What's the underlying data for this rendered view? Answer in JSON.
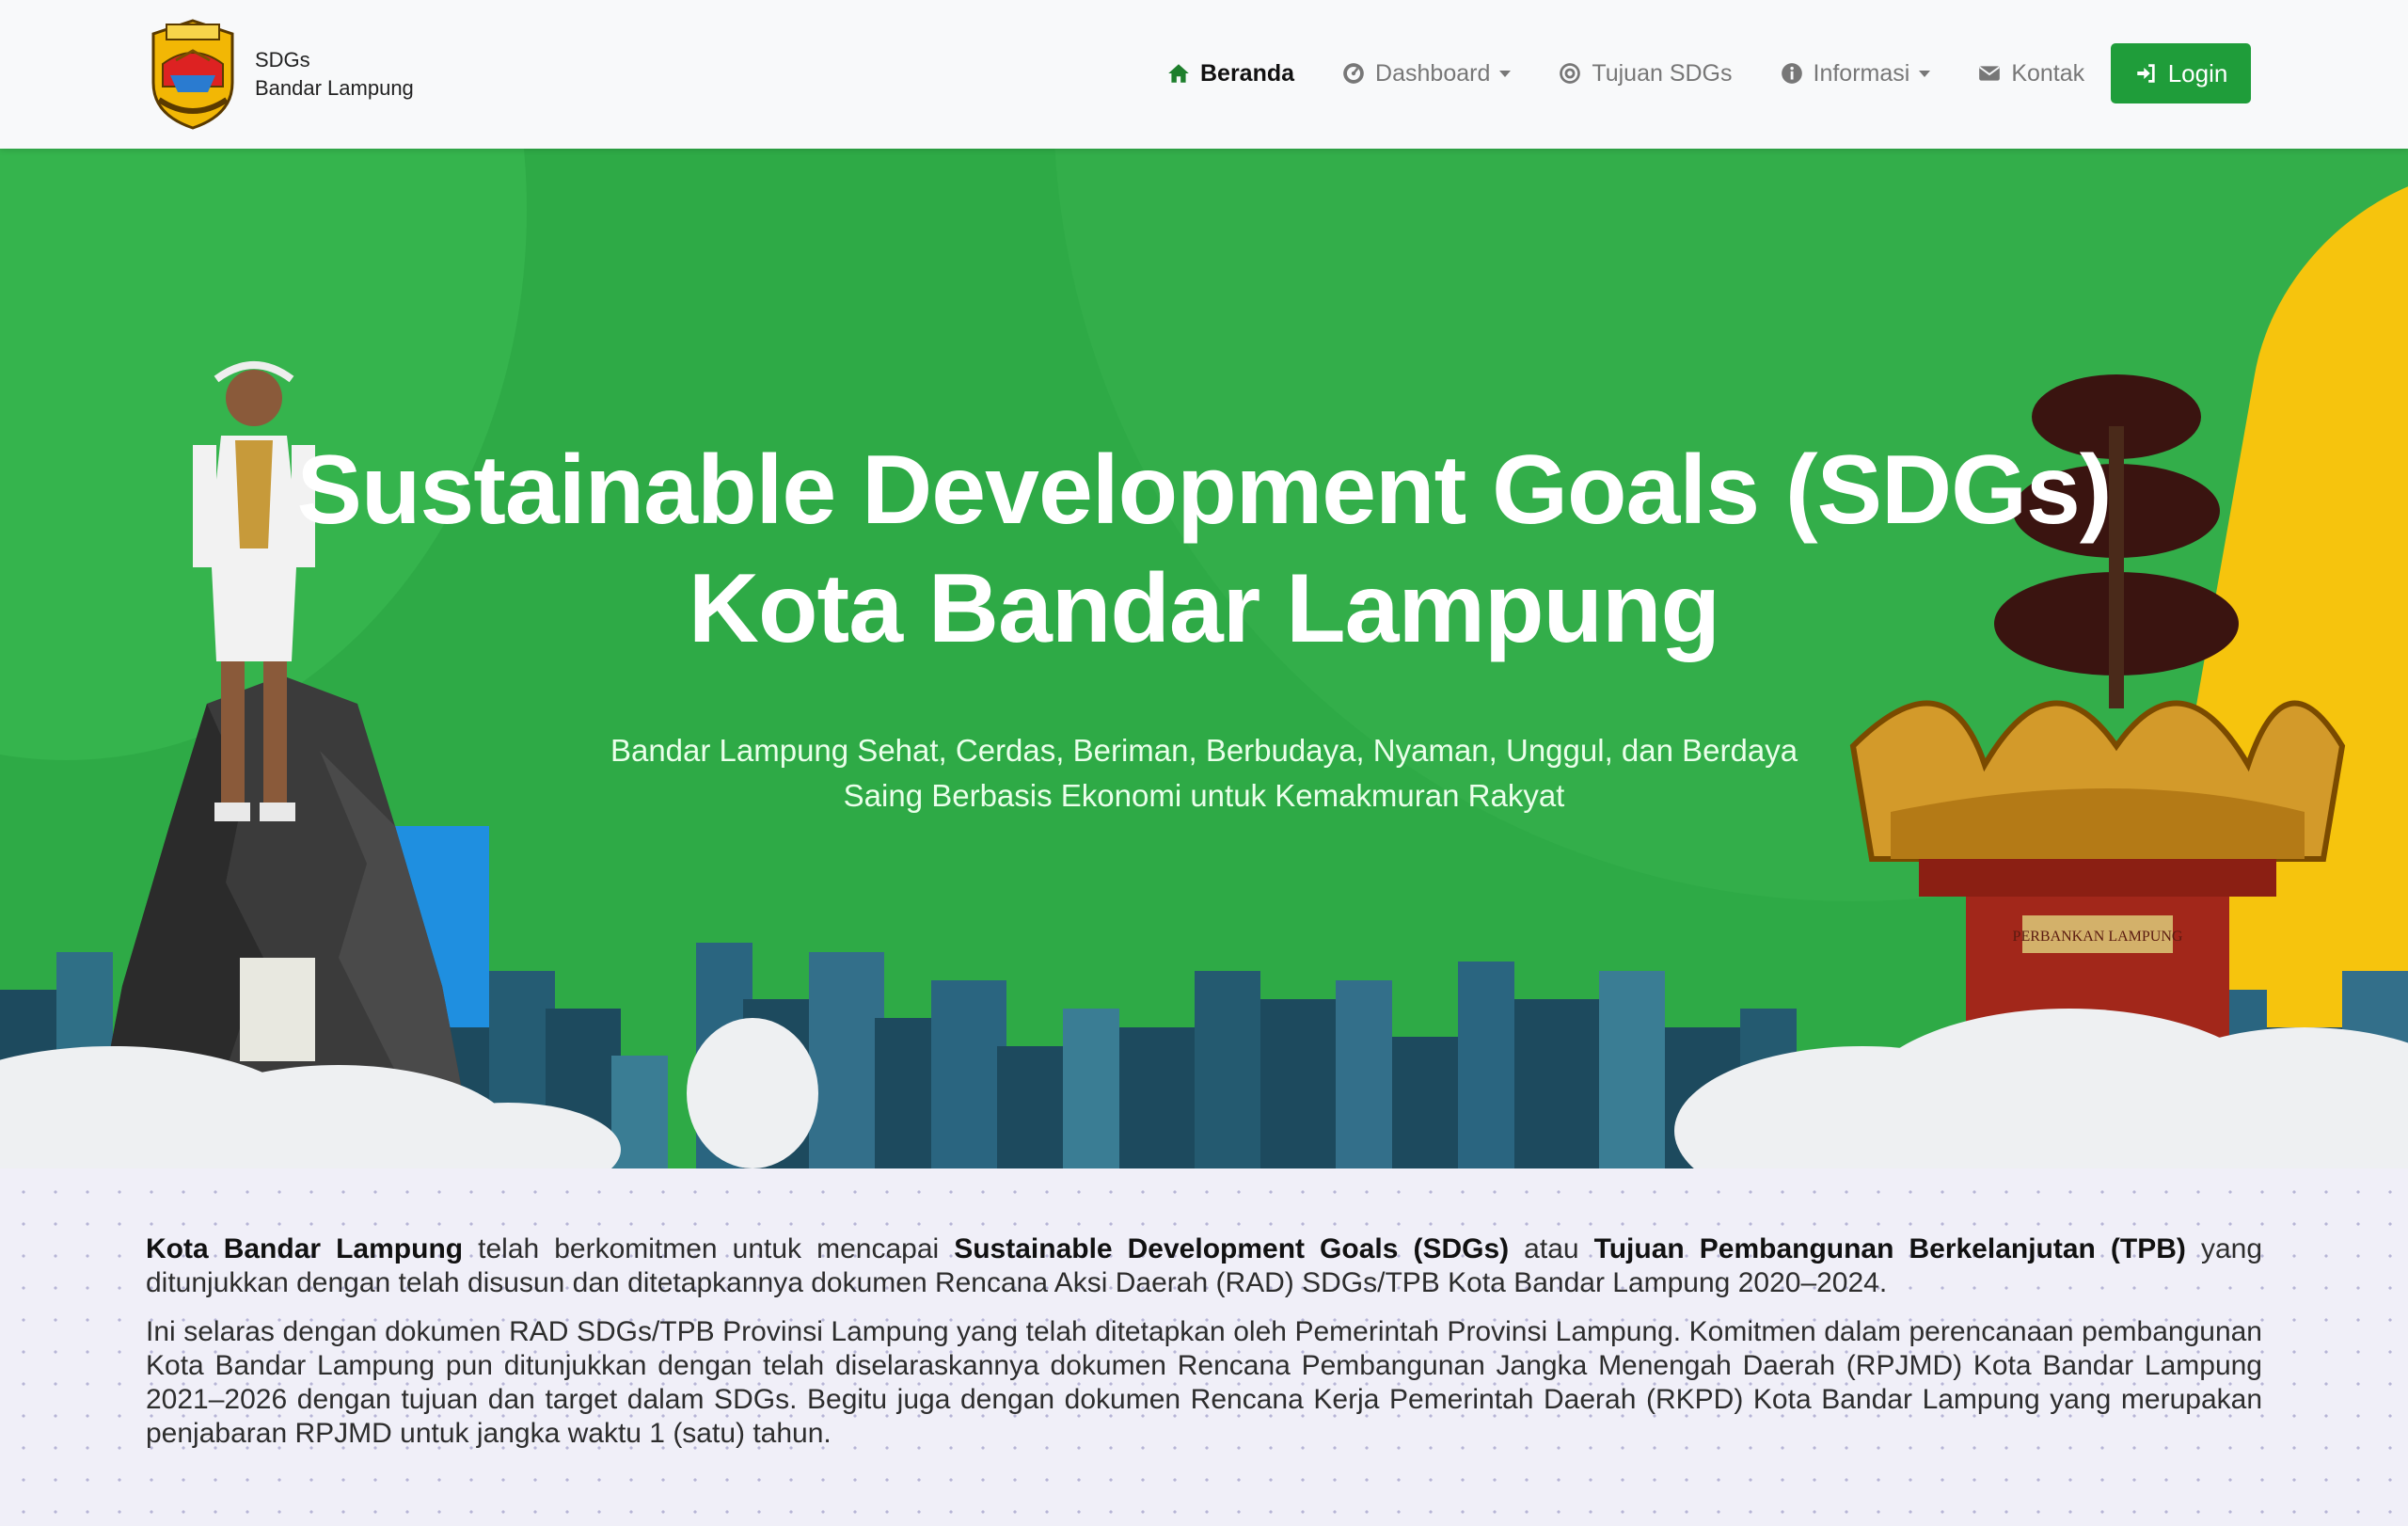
{
  "brand": {
    "line1": "SDGs",
    "line2": "Bandar Lampung",
    "logo_icon": "kota-bandar-lampung-emblem"
  },
  "nav": {
    "items": [
      {
        "label": "Beranda",
        "icon": "home-icon",
        "active": true
      },
      {
        "label": "Dashboard",
        "icon": "dashboard-icon",
        "dropdown": true
      },
      {
        "label": "Tujuan SDGs",
        "icon": "target-icon"
      },
      {
        "label": "Informasi",
        "icon": "info-icon",
        "dropdown": true
      },
      {
        "label": "Kontak",
        "icon": "envelope-icon"
      }
    ],
    "login_label": "Login"
  },
  "hero": {
    "title_line1": "Sustainable Development Goals (SDGs)",
    "title_line2": "Kota Bandar Lampung",
    "subtitle_line1": "Bandar Lampung Sehat, Cerdas, Beriman, Berbudaya, Nyaman, Unggul, dan Berdaya",
    "subtitle_line2": "Saing Berbasis Ekonomi untuk Kemakmuran Rakyat",
    "tower_plate": "PERBANKAN LAMPUNG"
  },
  "content": {
    "p1_b1": "Kota Bandar Lampung",
    "p1_t1": " telah berkomitmen untuk mencapai ",
    "p1_b2": "Sustainable Development Goals (SDGs)",
    "p1_t2": " atau ",
    "p1_b3": "Tujuan Pembangunan Berkelanjutan (TPB)",
    "p1_t3": " yang ditunjukkan dengan telah disusun dan ditetapkannya dokumen Rencana Aksi Daerah (RAD) SDGs/TPB Kota Bandar Lampung 2020–2024.",
    "p2": "Ini selaras dengan dokumen RAD SDGs/TPB Provinsi Lampung yang telah ditetapkan oleh Pemerintah Provinsi Lampung. Komitmen dalam perencanaan pembangunan Kota Bandar Lampung pun ditunjukkan dengan telah diselaraskannya dokumen Rencana Pembangunan Jangka Menengah Daerah (RPJMD) Kota Bandar Lampung 2021–2026 dengan tujuan dan target dalam SDGs. Begitu juga dengan dokumen Rencana Kerja Pemerintah Daerah (RKPD) Kota Bandar Lampung yang merupakan penjabaran RPJMD untuk jangka waktu 1 (satu) tahun."
  },
  "colors": {
    "primary_green": "#2eaa46",
    "login_green": "#1f9d3a",
    "accent_yellow": "#f6c40d",
    "accent_blue": "#1f8fe0"
  }
}
